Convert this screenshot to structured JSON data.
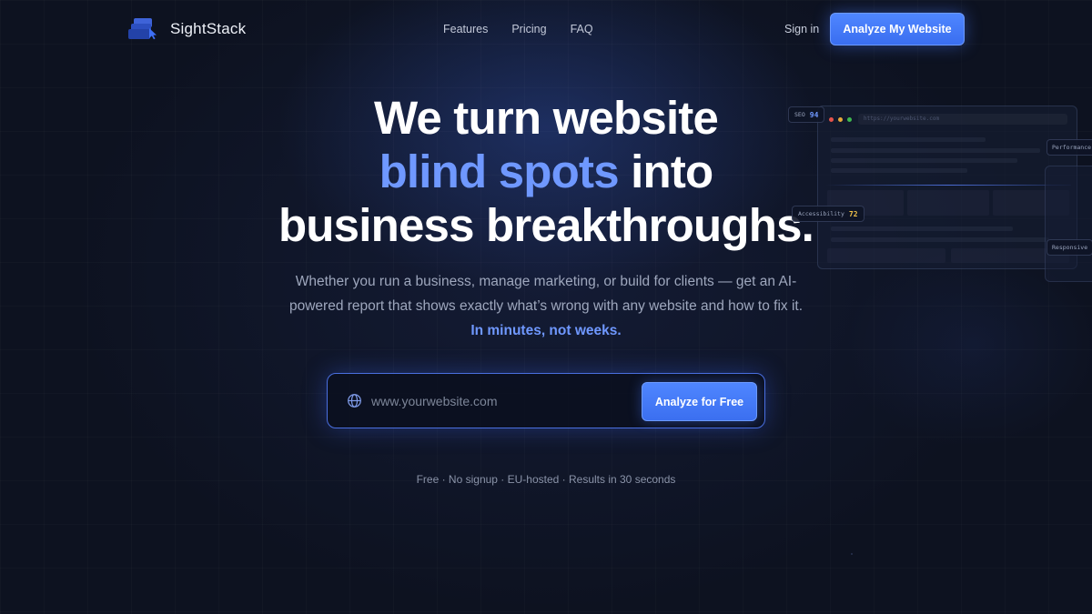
{
  "brand": {
    "name": "SightStack",
    "accent": "#4f86ff"
  },
  "nav": {
    "links": [
      "Features",
      "Pricing",
      "FAQ"
    ],
    "signin": "Sign in",
    "cta": "Analyze My Website"
  },
  "hero": {
    "line1": "We turn website",
    "line2_accent": "blind spots",
    "line2_rest": " into",
    "line3": "business breakthroughs.",
    "subtitle": "Whether you run a business, manage marketing, or build for clients — get an AI-powered report that shows exactly what’s wrong with any website and how to fix it. ",
    "subtitle_emphasis": "In minutes, not weeks."
  },
  "form": {
    "placeholder": "www.yourwebsite.com",
    "button": "Analyze for Free",
    "icon": "globe-icon"
  },
  "trust": "Free · No signup · EU-hosted · Results in 30 seconds",
  "mockup": {
    "url": "https://yourwebsite.com",
    "seo_label": "SEO",
    "seo_score": "94",
    "accessibility_label": "Accessibility",
    "accessibility_score": "72",
    "performance_label": "Performance",
    "responsive_label": "Responsive",
    "colors": {
      "seo": "#6f98ff",
      "accessibility": "#f0c24a",
      "dot_red": "#e5534b",
      "dot_yellow": "#e6a93a",
      "dot_green": "#3fb950"
    }
  }
}
